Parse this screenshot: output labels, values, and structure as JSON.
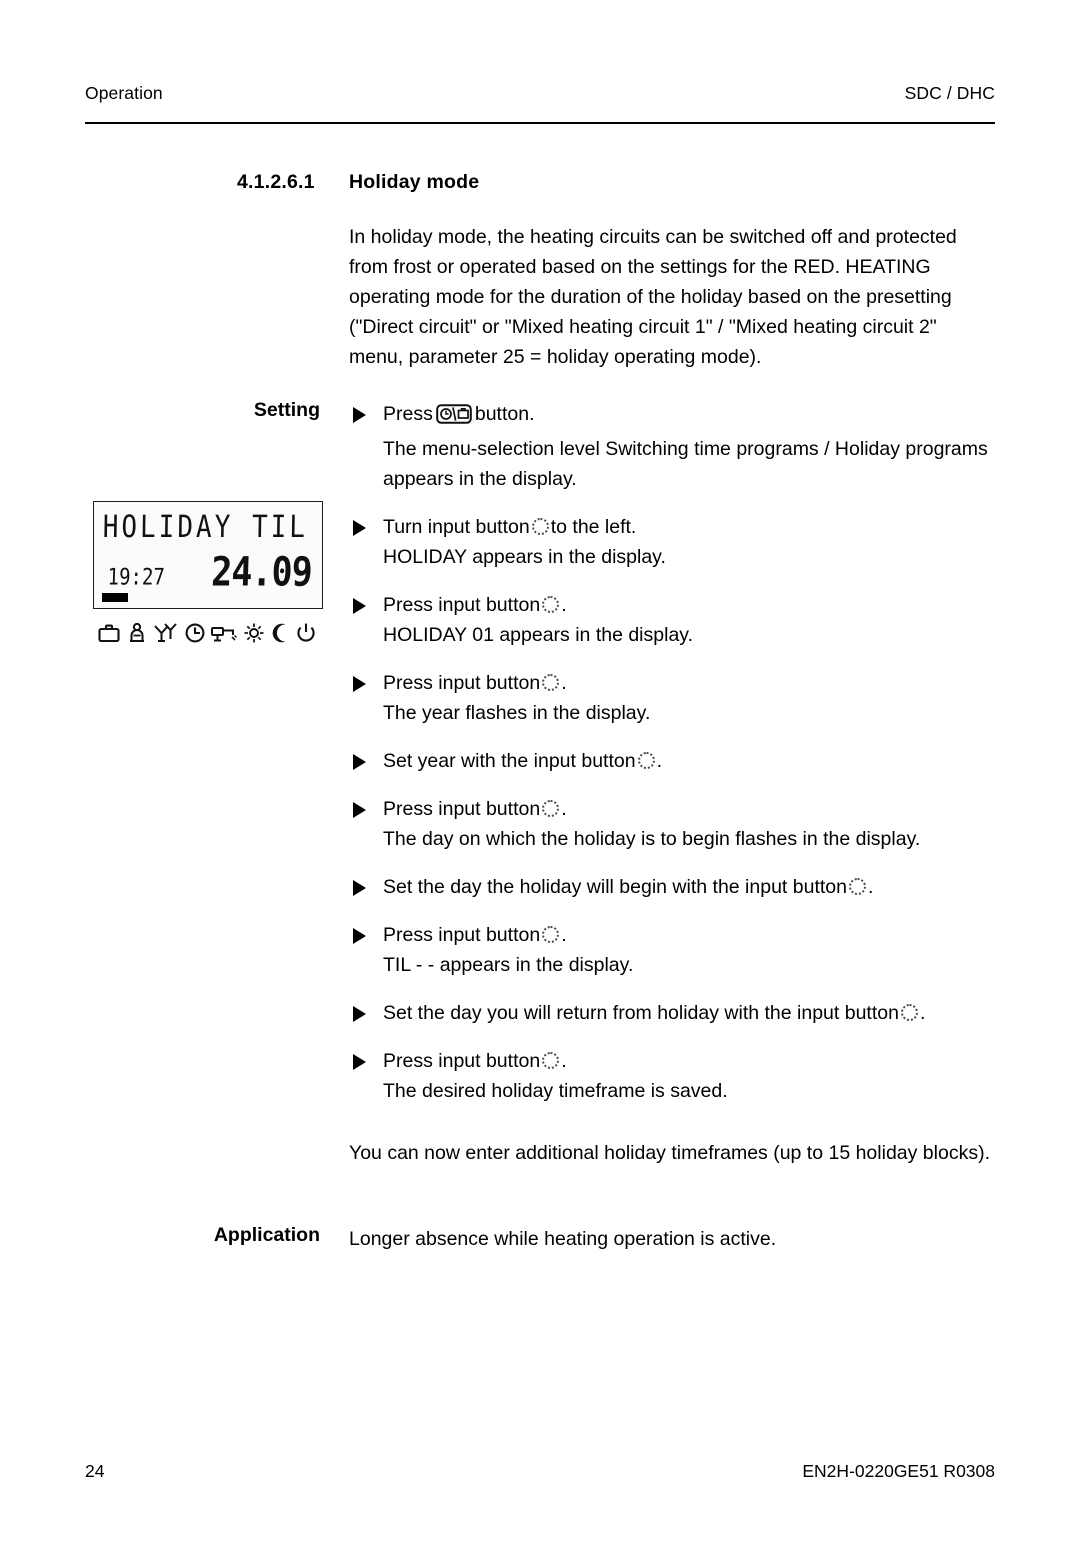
{
  "header": {
    "left": "Operation",
    "right": "SDC / DHC"
  },
  "section": {
    "number": "4.1.2.6.1",
    "title": "Holiday mode"
  },
  "intro": "In holiday mode, the heating circuits can be switched off and protected from frost or operated based on the settings for the RED. HEATING operating mode for the duration of the holiday based on the presetting (\"Direct circuit\" or \"Mixed heating circuit 1\" / \"Mixed heating circuit 2\" menu, parameter 25 = holiday operating mode).",
  "labels": {
    "setting": "Setting",
    "application": "Application"
  },
  "lcd": {
    "line1": "HOLIDAY TIL",
    "time": "19:27",
    "date": "24.09",
    "icons": [
      "suitcase-icon",
      "person-seated-icon",
      "cocktail-glasses-icon",
      "clock-icon",
      "tap-water-icon",
      "sun-icon",
      "moon-icon",
      "power-icon"
    ]
  },
  "steps": [
    {
      "pre": "Press",
      "icon": "program-button-icon",
      "post": "button.",
      "sub": "The menu-selection level Switching time programs / Holiday programs appears in the display."
    },
    {
      "pre": "Turn input button",
      "icon": "input-knob-icon",
      "post": "to the left.",
      "sub": "HOLIDAY appears in the display."
    },
    {
      "pre": "Press input button",
      "icon": "input-knob-icon",
      "post": ".",
      "sub": "HOLIDAY 01 appears in the display."
    },
    {
      "pre": "Press input button",
      "icon": "input-knob-icon",
      "post": ".",
      "sub": "The year flashes in the display."
    },
    {
      "pre": "Set year with the input button",
      "icon": "input-knob-icon",
      "post": ".",
      "sub": ""
    },
    {
      "pre": "Press input button",
      "icon": "input-knob-icon",
      "post": ".",
      "sub": "The day on which the holiday is to begin flashes in the display."
    },
    {
      "pre": "Set the day the holiday will begin with the input button",
      "icon": "input-knob-icon",
      "post": ".",
      "sub": ""
    },
    {
      "pre": "Press input button",
      "icon": "input-knob-icon",
      "post": ".",
      "sub": "TIL - - appears in the display."
    },
    {
      "pre": "Set the day you will return from holiday with the input button",
      "icon": "input-knob-icon",
      "post": ".",
      "sub": ""
    },
    {
      "pre": "Press input button",
      "icon": "input-knob-icon",
      "post": ".",
      "sub": "The desired holiday timeframe is saved."
    }
  ],
  "note": "You can now enter additional holiday timeframes (up to 15 holiday blocks).",
  "application_text": "Longer absence while heating operation is active.",
  "footer": {
    "page": "24",
    "doc_id": "EN2H-0220GE51 R0308"
  }
}
